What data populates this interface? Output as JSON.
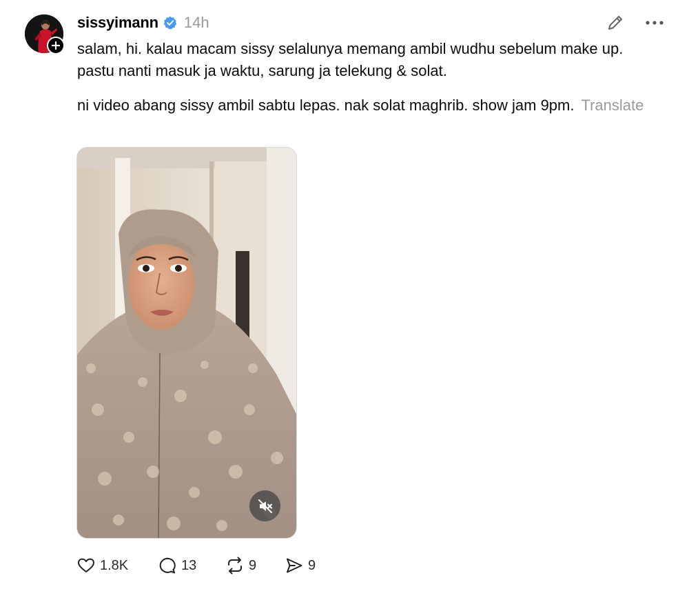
{
  "post": {
    "author": {
      "username": "sissyimann",
      "verified": true,
      "avatar_icon": "profile-photo",
      "follow_icon": "plus-icon"
    },
    "timestamp": "14h",
    "header_icons": {
      "edit": "pencil-icon",
      "more": "ellipsis-icon"
    },
    "text": {
      "paragraph_1": "salam, hi. kalau macam sissy selalunya memang ambil wudhu sebelum make up. pastu nanti masuk ja waktu, sarung ja telekung & solat.",
      "paragraph_2": "ni video abang sissy ambil sabtu lepas. nak solat maghrib. show jam 9pm.",
      "translate_label": "Translate"
    },
    "media": {
      "type": "video",
      "muted": true,
      "mute_icon": "speaker-muted-icon"
    },
    "actions": {
      "like": {
        "icon": "heart-icon",
        "count": "1.8K"
      },
      "reply": {
        "icon": "comment-bubble-icon",
        "count": "13"
      },
      "repost": {
        "icon": "repost-arrows-icon",
        "count": "9"
      },
      "share": {
        "icon": "send-icon",
        "count": "9"
      }
    }
  },
  "colors": {
    "text": "#0b0b0b",
    "muted": "#9a9a9a",
    "verified": "#4a98f0",
    "background": "#ffffff"
  }
}
